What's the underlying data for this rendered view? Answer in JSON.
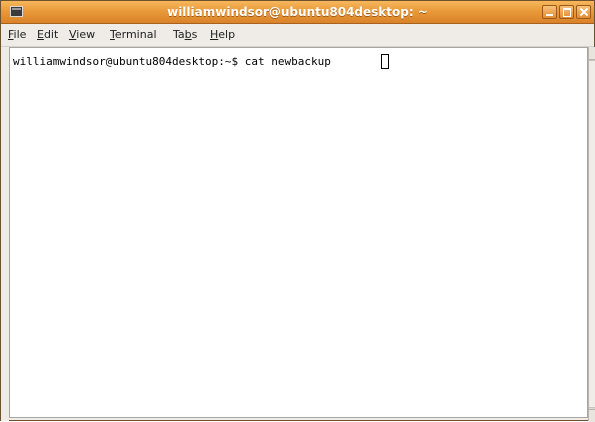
{
  "window": {
    "title": "williamwindsor@ubuntu804desktop: ~",
    "minimize_icon": "minimize-icon",
    "maximize_icon": "maximize-icon",
    "close_icon": "close-icon",
    "app_icon": "terminal-icon"
  },
  "menubar": {
    "file": {
      "u": "F",
      "rest": "ile"
    },
    "edit": {
      "u": "E",
      "rest": "dit"
    },
    "view": {
      "u": "V",
      "rest": "iew"
    },
    "terminal": {
      "u": "T",
      "rest": "erminal"
    },
    "tabs": {
      "pre": "Ta",
      "u": "b",
      "rest": "s"
    },
    "help": {
      "u": "H",
      "rest": "elp"
    }
  },
  "terminal": {
    "prompt": "williamwindsor@ubuntu804desktop:~$ ",
    "command": "cat newbackup"
  },
  "colors": {
    "titlebar": "#e99a3a",
    "background": "#ffffff",
    "text": "#000000"
  }
}
